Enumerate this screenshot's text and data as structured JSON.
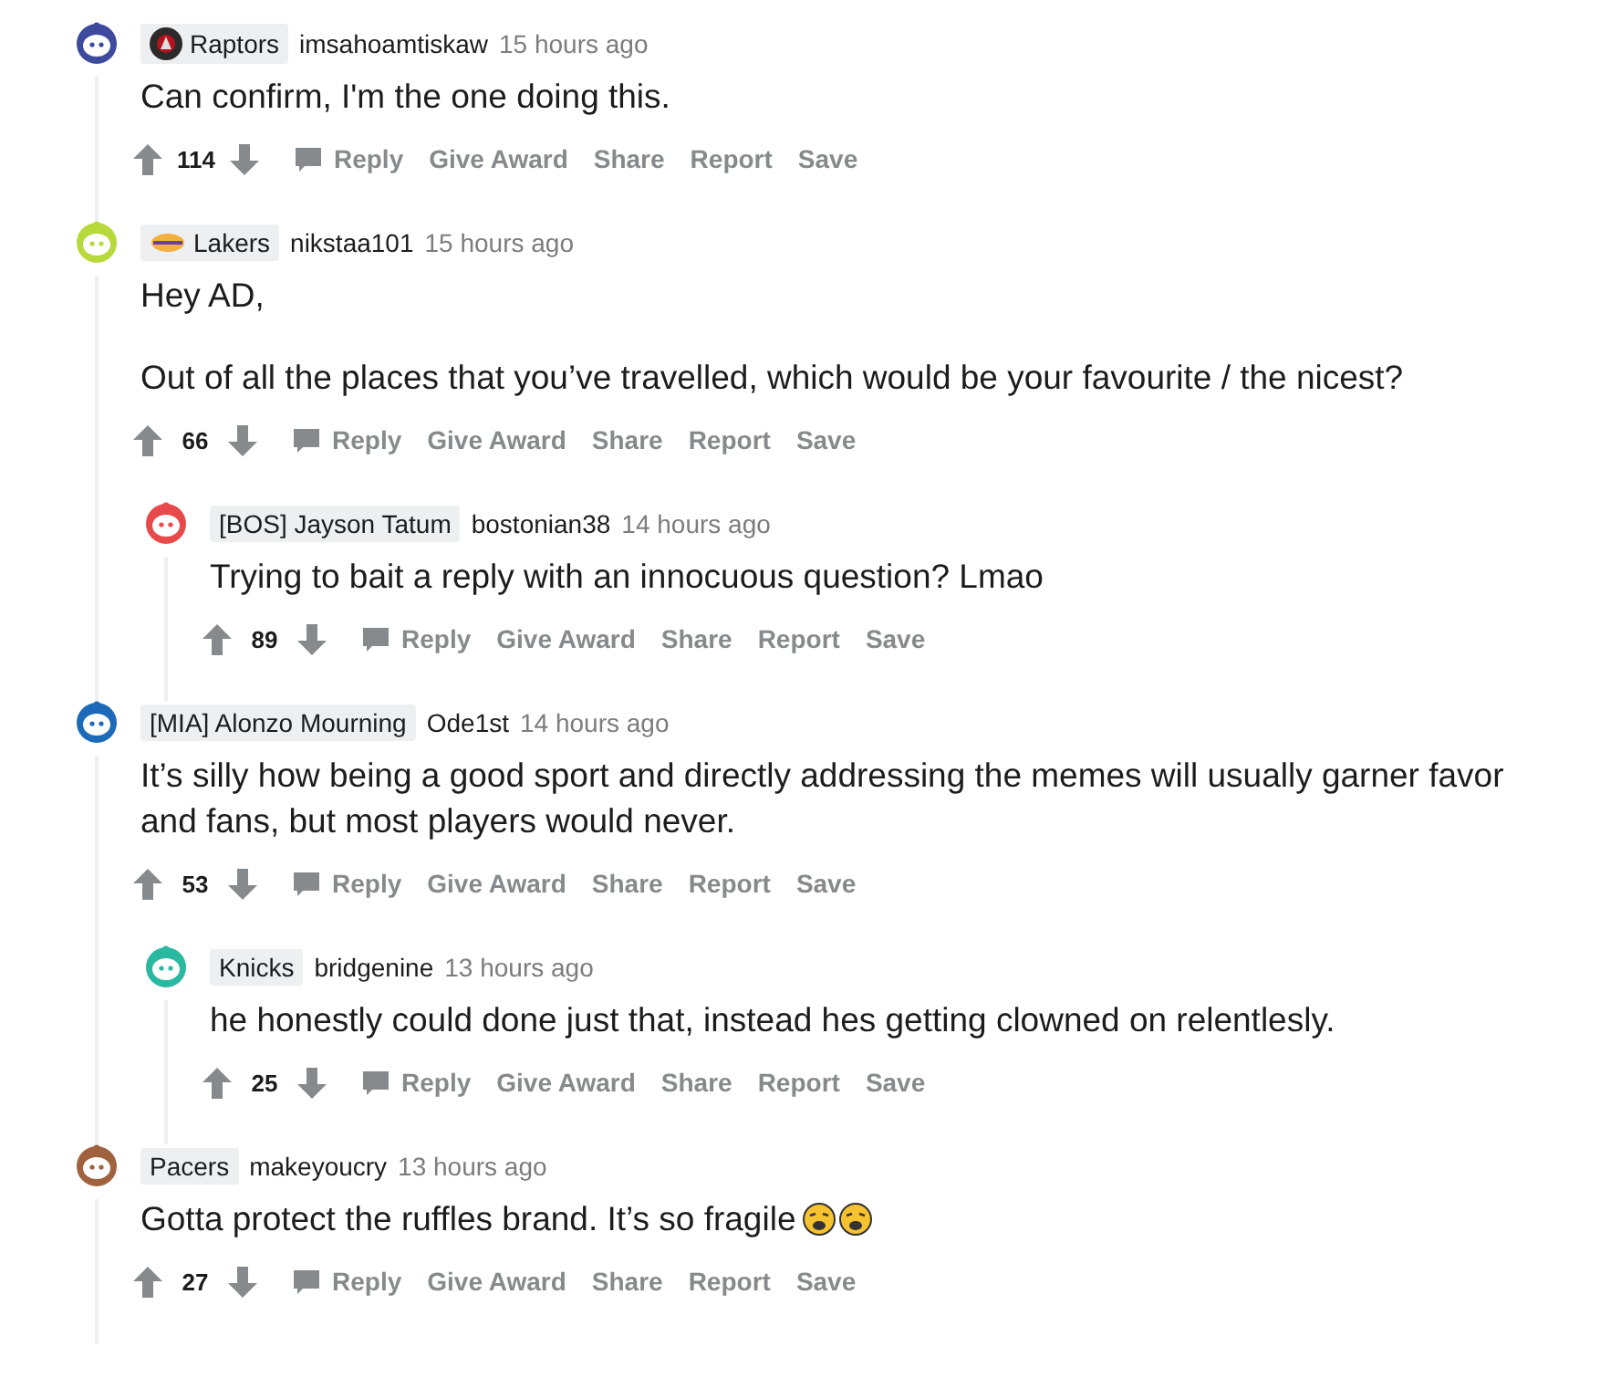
{
  "comments": [
    {
      "color": "#3d4a9e",
      "flair": {
        "text": "Raptors",
        "kind": "dark_logo"
      },
      "username": "imsahoamtiskaw",
      "time": "15 hours ago",
      "body": [
        "Can confirm, I'm the one doing this."
      ],
      "votes": "114",
      "actions": [
        {
          "label": "Reply",
          "kind": "reply"
        },
        {
          "label": "Give Award",
          "kind": "plain"
        },
        {
          "label": "Share",
          "kind": "plain"
        },
        {
          "label": "Report",
          "kind": "plain"
        },
        {
          "label": "Save",
          "kind": "plain"
        }
      ]
    },
    {
      "color": "#b7d93b",
      "flair": {
        "text": "Lakers",
        "kind": "gold_logo"
      },
      "username": "nikstaa101",
      "time": "15 hours ago",
      "body": [
        "Hey AD,",
        "Out of all the places that you’ve travelled, which would be your favourite / the nicest?"
      ],
      "votes": "66",
      "actions": [
        {
          "label": "Reply",
          "kind": "reply"
        },
        {
          "label": "Give Award",
          "kind": "plain"
        },
        {
          "label": "Share",
          "kind": "plain"
        },
        {
          "label": "Report",
          "kind": "plain"
        },
        {
          "label": "Save",
          "kind": "plain"
        }
      ],
      "children": [
        {
          "color": "#e8494b",
          "flair": {
            "text": "[BOS] Jayson Tatum"
          },
          "username": "bostonian38",
          "time": "14 hours ago",
          "body": [
            "Trying to bait a reply with an innocuous question? Lmao"
          ],
          "votes": "89",
          "actions": [
            {
              "label": "Reply",
              "kind": "reply"
            },
            {
              "label": "Give Award",
              "kind": "plain"
            },
            {
              "label": "Share",
              "kind": "plain"
            },
            {
              "label": "Report",
              "kind": "plain"
            },
            {
              "label": "Save",
              "kind": "plain"
            }
          ]
        }
      ]
    },
    {
      "color": "#1d6bb8",
      "flair": {
        "text": "[MIA] Alonzo Mourning"
      },
      "username": "Ode1st",
      "time": "14 hours ago",
      "body": [
        "It’s silly how being a good sport and directly addressing the memes will usually garner favor and fans, but most players would never."
      ],
      "votes": "53",
      "actions": [
        {
          "label": "Reply",
          "kind": "reply"
        },
        {
          "label": "Give Award",
          "kind": "plain"
        },
        {
          "label": "Share",
          "kind": "plain"
        },
        {
          "label": "Report",
          "kind": "plain"
        },
        {
          "label": "Save",
          "kind": "plain"
        }
      ],
      "children": [
        {
          "color": "#2bb8a0",
          "flair": {
            "text": "Knicks"
          },
          "username": "bridgenine",
          "time": "13 hours ago",
          "body": [
            "he honestly could done just that, instead hes getting clowned on relentlesly."
          ],
          "votes": "25",
          "actions": [
            {
              "label": "Reply",
              "kind": "reply"
            },
            {
              "label": "Give Award",
              "kind": "plain"
            },
            {
              "label": "Share",
              "kind": "plain"
            },
            {
              "label": "Report",
              "kind": "plain"
            },
            {
              "label": "Save",
              "kind": "plain"
            }
          ]
        }
      ]
    },
    {
      "color": "#a0613e",
      "flair": {
        "text": "Pacers"
      },
      "username": "makeyoucry",
      "time": "13 hours ago",
      "body": [
        "Gotta protect the ruffles brand. It’s so fragile"
      ],
      "emojis": [
        {
          "kind": "weary"
        },
        {
          "kind": "weary"
        }
      ],
      "votes": "27",
      "actions": [
        {
          "label": "Reply",
          "kind": "reply"
        },
        {
          "label": "Give Award",
          "kind": "plain"
        },
        {
          "label": "Share",
          "kind": "plain"
        },
        {
          "label": "Report",
          "kind": "plain"
        },
        {
          "label": "Save",
          "kind": "plain"
        }
      ]
    }
  ]
}
